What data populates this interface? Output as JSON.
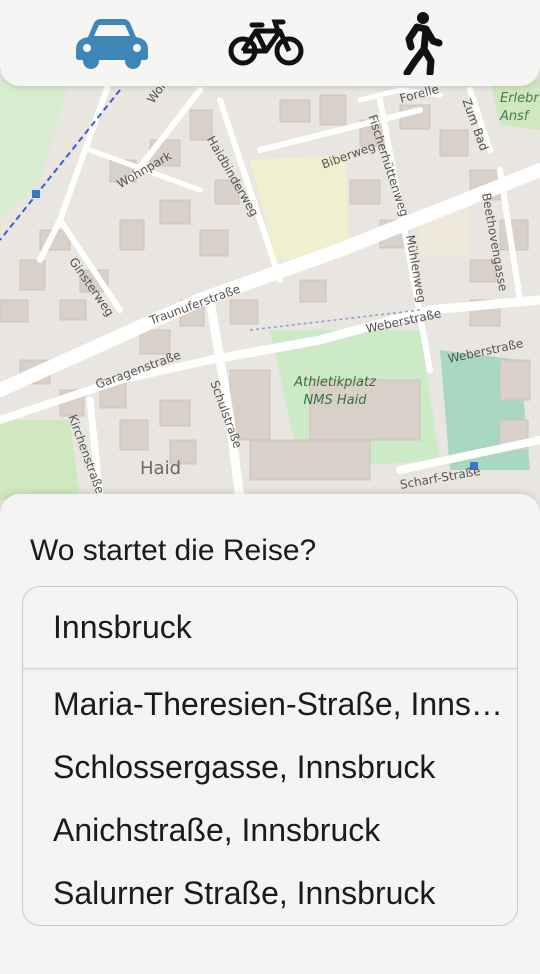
{
  "modes": [
    {
      "name": "car",
      "icon": "car-icon",
      "active": true,
      "color": "#3f86b8"
    },
    {
      "name": "bike",
      "icon": "bicycle-icon",
      "active": false,
      "color": "#111111"
    },
    {
      "name": "walk",
      "icon": "walking-person-icon",
      "active": false,
      "color": "#111111"
    }
  ],
  "map": {
    "streets": [
      "Wohnpark",
      "Wohnpark",
      "Haidbinderweg",
      "Biberweg",
      "Fischerhüttenweg",
      "Forelle",
      "Zum Bad",
      "Beethovengasse",
      "Mühlenweg",
      "Ginsterweg",
      "Traunuferstraße",
      "Weberstraße",
      "Weberstraße",
      "Garagenstraße",
      "Schulstraße",
      "Kirchenstraße",
      "Scharf-Straße"
    ],
    "poi_line1": "Athletikplatz",
    "poi_line2": "NMS Haid",
    "place": "Haid",
    "corner_line1": "Erlebr",
    "corner_line2": "Ansf"
  },
  "sheet": {
    "title": "Wo startet die Reise?",
    "input_value": "Innsbruck",
    "suggestions": [
      "Maria-Theresien-Straße, Innsbruck",
      "Schlossergasse, Innsbruck",
      "Anichstraße, Innsbruck",
      "Salurner Straße, Innsbruck"
    ]
  }
}
